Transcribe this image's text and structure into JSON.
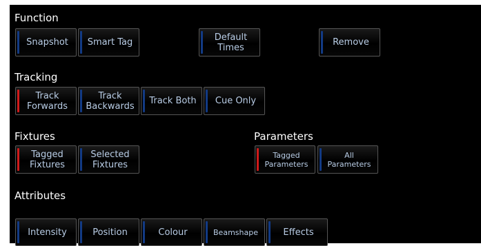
{
  "sections": {
    "function": "Function",
    "tracking": "Tracking",
    "fixtures": "Fixtures",
    "parameters": "Parameters",
    "attributes": "Attributes"
  },
  "buttons": {
    "snapshot": "Snapshot",
    "smart_tag": "Smart Tag",
    "default_times": "Default\nTimes",
    "remove": "Remove",
    "track_forwards": "Track\nForwards",
    "track_backwards": "Track\nBackwards",
    "track_both": "Track Both",
    "cue_only": "Cue Only",
    "tagged_fixtures": "Tagged\nFixtures",
    "selected_fixtures": "Selected\nFixtures",
    "tagged_parameters": "Tagged\nParameters",
    "all_parameters": "All\nParameters",
    "intensity": "Intensity",
    "position": "Position",
    "colour": "Colour",
    "beamshape": "Beamshape",
    "effects": "Effects"
  },
  "colors": {
    "background": "#000000",
    "heading_text": "#ffffff",
    "button_text": "#b9cde6",
    "indicator_inactive": "#123a84",
    "indicator_active": "#cf1a1a"
  },
  "active_buttons": [
    "track_forwards",
    "tagged_fixtures",
    "tagged_parameters"
  ]
}
